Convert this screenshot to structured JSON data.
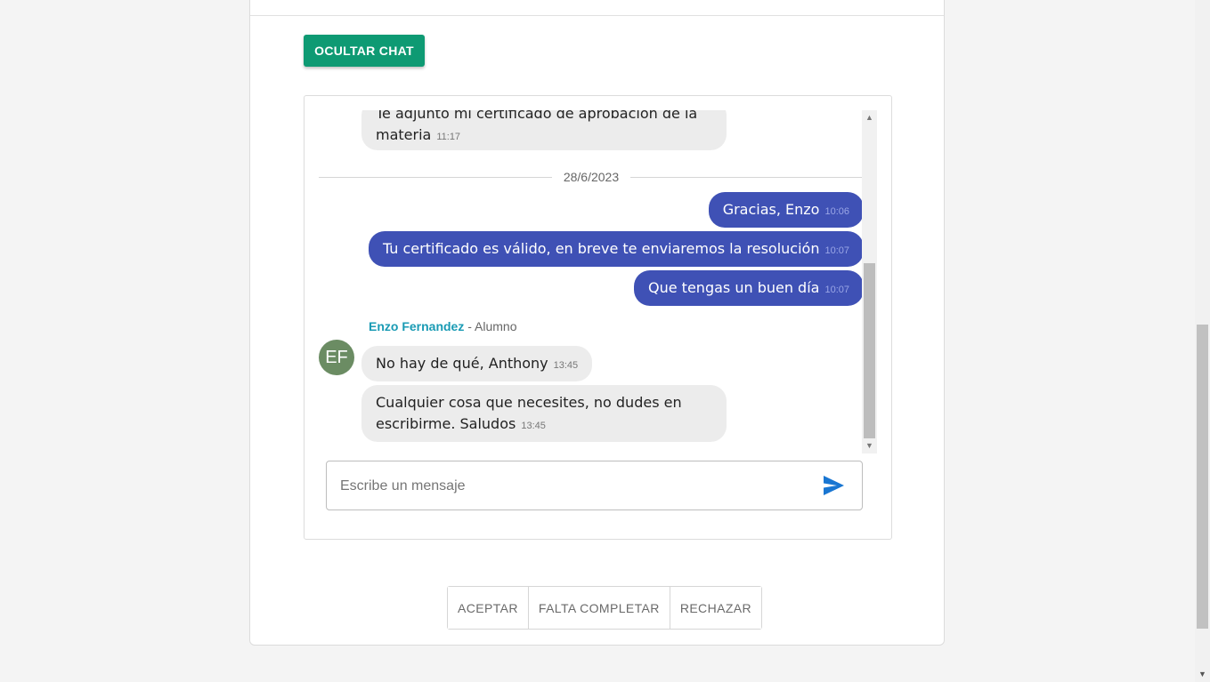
{
  "buttons": {
    "hide_chat": "OCULTAR CHAT"
  },
  "chat": {
    "date_separator": "28/6/2023",
    "prev_message": {
      "text_partial": "Te adjunto mi certificado de aprobación de la",
      "text_line2": "materia",
      "time": "11:17"
    },
    "outgoing": [
      {
        "text": "Gracias, Enzo",
        "time": "10:06"
      },
      {
        "text": "Tu certificado es válido, en breve te enviaremos la resolución",
        "time": "10:07"
      },
      {
        "text": "Que tengas un buen día",
        "time": "10:07"
      }
    ],
    "sender": {
      "name": "Enzo Fernandez",
      "role": "- Alumno",
      "initials": "EF"
    },
    "incoming": [
      {
        "text": "No hay de qué, Anthony",
        "time": "13:45"
      },
      {
        "text_line1": "Cualquier cosa que necesites, no dudes en",
        "text_line2": "escribirme. Saludos",
        "time": "13:45"
      }
    ],
    "input_placeholder": "Escribe un mensaje"
  },
  "actions": {
    "accept": "ACEPTAR",
    "incomplete": "FALTA COMPLETAR",
    "reject": "RECHAZAR"
  },
  "colors": {
    "primary_green": "#0e9a73",
    "outgoing_bubble": "#3f51b5",
    "incoming_bubble": "#ececec",
    "sender_name": "#1a9bb4",
    "avatar": "#6b8c63",
    "send_icon": "#1976d2"
  },
  "icons": {
    "send": "send-icon"
  }
}
